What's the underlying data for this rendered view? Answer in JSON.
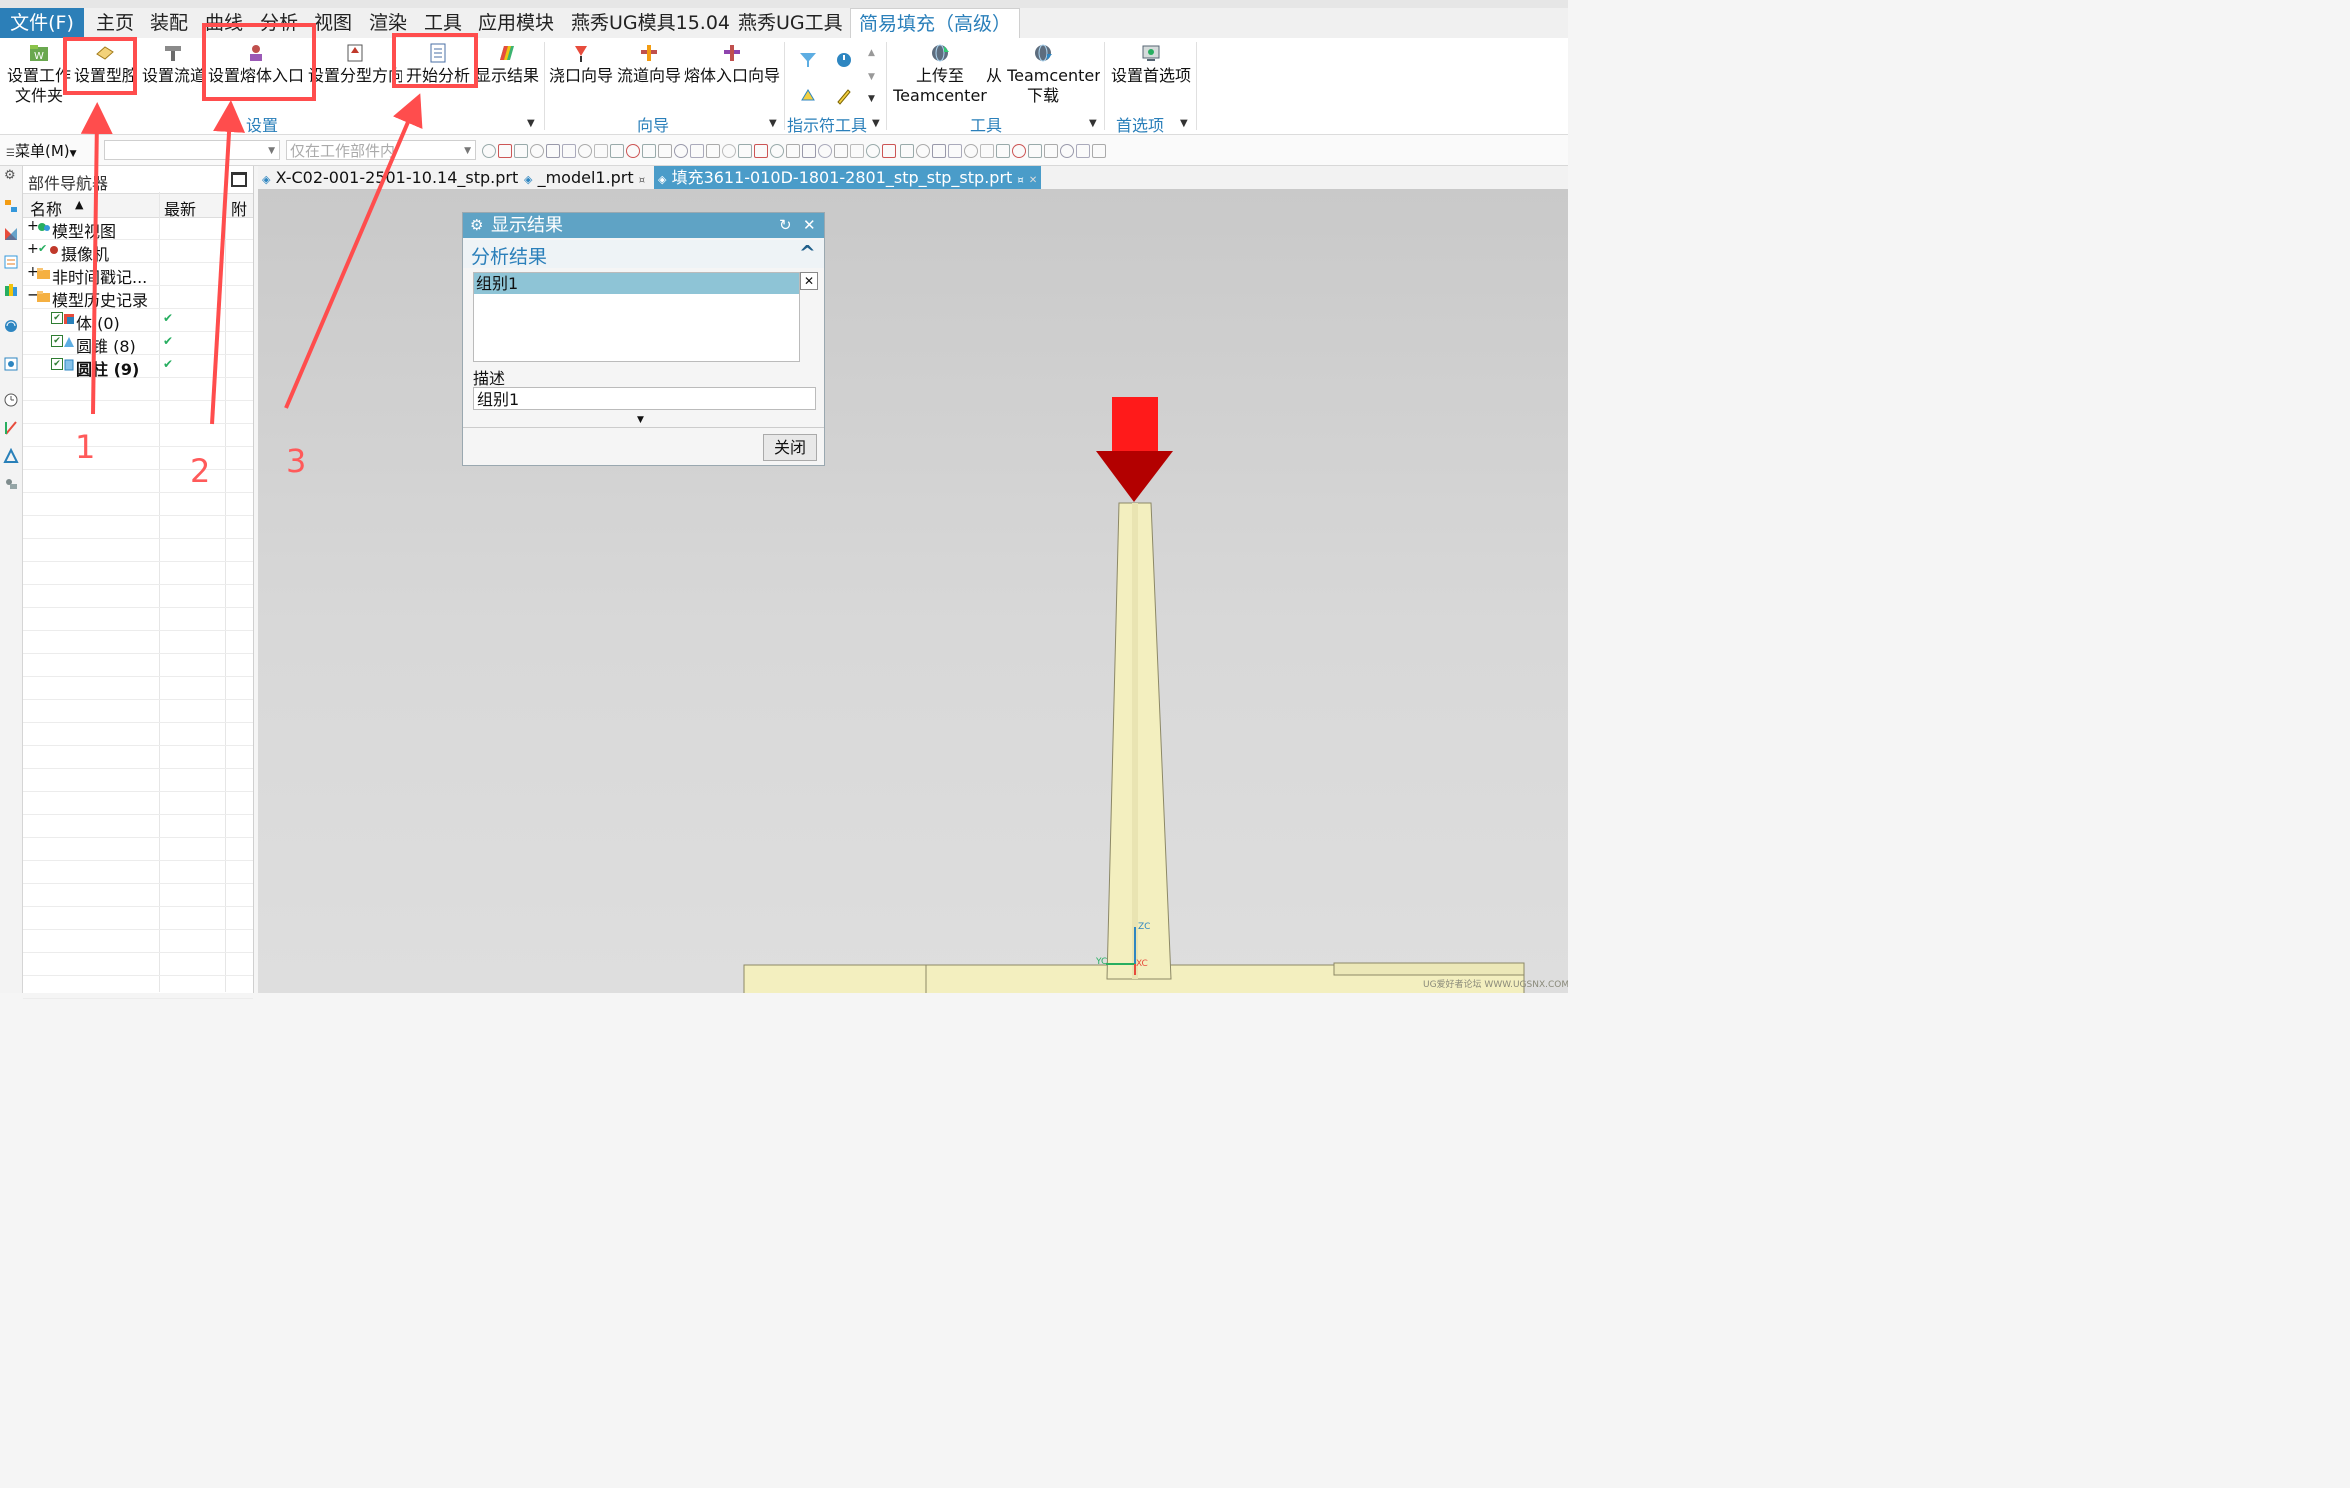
{
  "menu_tabs": [
    "文件(F)",
    "主页",
    "装配",
    "曲线",
    "分析",
    "视图",
    "渲染",
    "工具",
    "应用模块",
    "燕秀UG模具15.04",
    "燕秀UG工具",
    "简易填充（高级）"
  ],
  "ribbon": {
    "buttons": [
      {
        "line1": "设置工作",
        "line2": "文件夹"
      },
      {
        "line1": "设置型腔",
        "line2": ""
      },
      {
        "line1": "设置流道",
        "line2": ""
      },
      {
        "line1": "设置熔体入口",
        "line2": ""
      },
      {
        "line1": "设置分型方向",
        "line2": ""
      },
      {
        "line1": "开始分析",
        "line2": ""
      },
      {
        "line1": "显示结果",
        "line2": ""
      },
      {
        "line1": "浇口向导",
        "line2": ""
      },
      {
        "line1": "流道向导",
        "line2": ""
      },
      {
        "line1": "熔体入口向导",
        "line2": ""
      },
      {
        "line1": "上传至",
        "line2": "Teamcenter"
      },
      {
        "line1": "从 Teamcenter",
        "line2": "下载"
      },
      {
        "line1": "设置首选项",
        "line2": ""
      }
    ],
    "groups": [
      "设置",
      "向导",
      "指示符工具",
      "工具",
      "首选项"
    ]
  },
  "toolbar": {
    "menu_label": "菜单(M)",
    "filter_placeholder": "仅在工作部件内"
  },
  "navigator": {
    "title": "部件导航器",
    "col_name": "名称",
    "col_latest": "最新",
    "col_attached": "附",
    "rows": [
      {
        "label": "模型视图",
        "check": ""
      },
      {
        "label": "摄像机",
        "check": ""
      },
      {
        "label": "非时间戳记...",
        "check": ""
      },
      {
        "label": "模型历史记录",
        "check": ""
      },
      {
        "label": "体 (0)",
        "check": "✔"
      },
      {
        "label": "圆锥 (8)",
        "check": "✔"
      },
      {
        "label": "圆柱 (9)",
        "check": "✔"
      }
    ]
  },
  "doc_tabs": [
    "X-C02-001-2501-10.14_stp.prt",
    "_model1.prt",
    "填充3611-010D-1801-2801_stp_stp_stp.prt"
  ],
  "dialog": {
    "title": "显示结果",
    "section": "分析结果",
    "list_item": "组别1",
    "desc_label": "描述",
    "desc_value": "组别1",
    "close_button": "关闭"
  },
  "annotations": [
    "1",
    "2",
    "3"
  ],
  "axis": {
    "zc": "ZC",
    "yc": "YC",
    "xc": "XC"
  },
  "watermark": "UG爱好者论坛 WWW.UGSNX.COM",
  "colors": {
    "accent": "#2a7fba",
    "dialog_title": "#5fa3c5",
    "annotation": "#ff4d4d",
    "part": "#f3efbf"
  }
}
